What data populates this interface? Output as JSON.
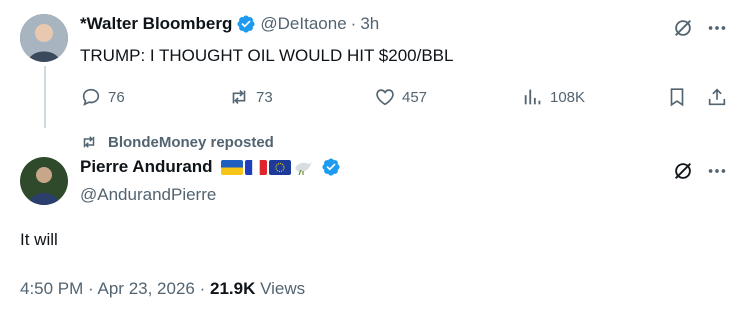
{
  "tweet1": {
    "name": "*Walter Bloomberg",
    "handle": "@DeItaone",
    "dot": "·",
    "time": "3h",
    "text": "TRUMP: I THOUGHT OIL WOULD HIT $200/BBL",
    "stats": {
      "replies": "76",
      "reposts": "73",
      "likes": "457",
      "views": "108K"
    }
  },
  "repost_banner": {
    "label": "BlondeMoney reposted"
  },
  "tweet2": {
    "name": "Pierre Andurand",
    "handle": "@AndurandPierre",
    "text": "It will",
    "time": "4:50 PM",
    "sep": "·",
    "date": "Apr 23, 2026",
    "views_count": "21.9K",
    "views_label": "Views"
  },
  "colors": {
    "verified": "#1d9bf0",
    "muted": "#536471",
    "text": "#0f1419",
    "thread_line": "#cfd9de"
  },
  "icons": [
    "grok-icon",
    "more-icon",
    "reply-icon",
    "repost-icon",
    "like-icon",
    "views-icon",
    "bookmark-icon",
    "share-icon",
    "verified-icon",
    "dove-icon"
  ]
}
